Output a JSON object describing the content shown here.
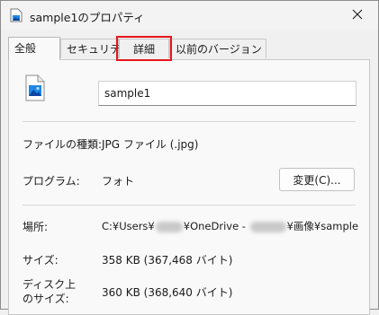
{
  "window": {
    "title": "sample1のプロパティ",
    "title_icon": "photo-file-icon",
    "close_icon": "close-icon"
  },
  "tabs": [
    {
      "label": "全般",
      "active": true
    },
    {
      "label": "セキュリティ",
      "active": false
    },
    {
      "label": "詳細",
      "active": false,
      "highlighted": true
    },
    {
      "label": "以前のバージョン",
      "active": false
    }
  ],
  "general": {
    "file_icon": "photo-file-icon",
    "file_name": "sample1",
    "file_type_label": "ファイルの種類:",
    "file_type_value": "JPG ファイル (.jpg)",
    "program_label": "プログラム:",
    "program_value": "フォト",
    "change_button": "変更(C)...",
    "location_label": "場所:",
    "location_part1": "C:¥Users¥",
    "location_part2": "¥OneDrive - ",
    "location_part3": "¥画像¥sample",
    "size_label": "サイズ:",
    "size_value": "358 KB (367,468 バイト)",
    "disk_size_label_line1": "ディスク上",
    "disk_size_label_line2": "のサイズ:",
    "disk_size_value": "360 KB (368,640 バイト)"
  },
  "colors": {
    "highlight_outline": "#e8141a",
    "icon_blue": "#1e88e5"
  }
}
